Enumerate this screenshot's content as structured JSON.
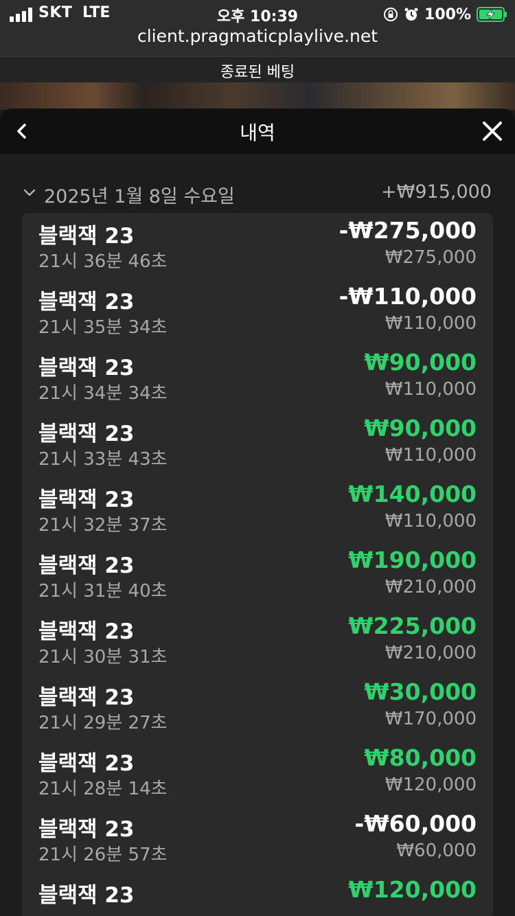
{
  "status_bar": {
    "carrier": "SKT",
    "network": "LTE",
    "time": "오후 10:39",
    "battery": "100%"
  },
  "browser": {
    "url": "client.pragmaticplaylive.net"
  },
  "topbar": {
    "title": "종료된 베팅"
  },
  "sheet": {
    "title": "내역"
  },
  "date_group": {
    "label": "2025년 1월 8일 수요일",
    "total": "+₩915,000"
  },
  "colors": {
    "win": "#2ed36b",
    "loss": "#ffffff",
    "muted": "#a8a8a8"
  },
  "items": [
    {
      "game": "블랙잭 23",
      "time": "21시 36분 46초",
      "result": "-₩275,000",
      "outcome": "loss",
      "stake": "₩275,000"
    },
    {
      "game": "블랙잭 23",
      "time": "21시 35분 34초",
      "result": "-₩110,000",
      "outcome": "loss",
      "stake": "₩110,000"
    },
    {
      "game": "블랙잭 23",
      "time": "21시 34분 34초",
      "result": "₩90,000",
      "outcome": "win",
      "stake": "₩110,000"
    },
    {
      "game": "블랙잭 23",
      "time": "21시 33분 43초",
      "result": "₩90,000",
      "outcome": "win",
      "stake": "₩110,000"
    },
    {
      "game": "블랙잭 23",
      "time": "21시 32분 37초",
      "result": "₩140,000",
      "outcome": "win",
      "stake": "₩110,000"
    },
    {
      "game": "블랙잭 23",
      "time": "21시 31분 40초",
      "result": "₩190,000",
      "outcome": "win",
      "stake": "₩210,000"
    },
    {
      "game": "블랙잭 23",
      "time": "21시 30분 31초",
      "result": "₩225,000",
      "outcome": "win",
      "stake": "₩210,000"
    },
    {
      "game": "블랙잭 23",
      "time": "21시 29분 27초",
      "result": "₩30,000",
      "outcome": "win",
      "stake": "₩170,000"
    },
    {
      "game": "블랙잭 23",
      "time": "21시 28분 14초",
      "result": "₩80,000",
      "outcome": "win",
      "stake": "₩120,000"
    },
    {
      "game": "블랙잭 23",
      "time": "21시 26분 57초",
      "result": "-₩60,000",
      "outcome": "loss",
      "stake": "₩60,000"
    },
    {
      "game": "블랙잭 23",
      "time": "",
      "result": "₩120,000",
      "outcome": "win",
      "stake": ""
    }
  ]
}
